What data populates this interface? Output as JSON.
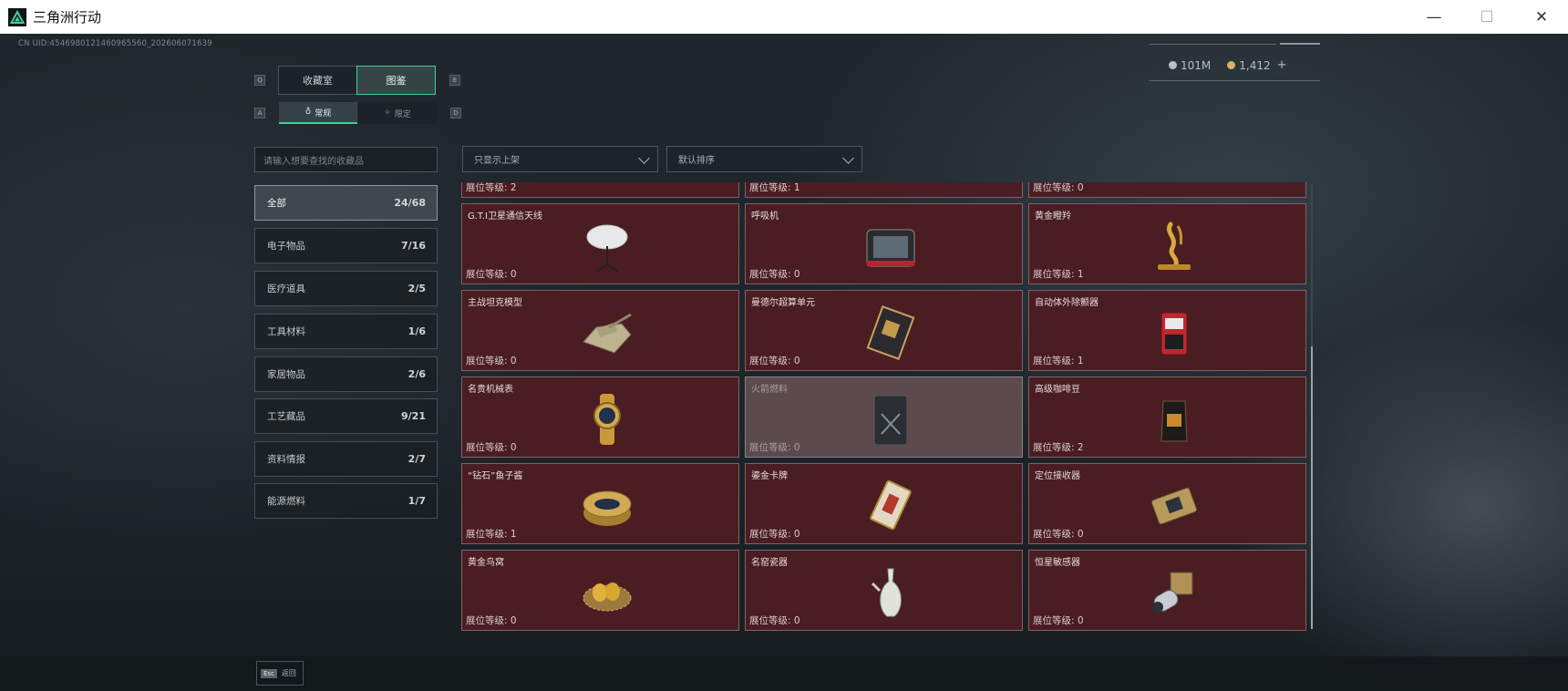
{
  "window": {
    "title": "三角洲行动",
    "controls": {
      "minimize": "—",
      "maximize": "☐",
      "close": "✕"
    }
  },
  "uid": "CN UID:4546980121460965560_202606071639",
  "currency": {
    "silver": "101M",
    "gold": "1,412",
    "add": "+"
  },
  "tabs": {
    "collection_room": "收藏室",
    "catalog": "图鉴"
  },
  "key_hints": {
    "left_tab": "Q",
    "right_tab": "E",
    "left_sub": "A",
    "right_sub": "D"
  },
  "subtabs": {
    "regular": "常规",
    "limited": "限定"
  },
  "search": {
    "placeholder": "请输入想要查找的收藏品"
  },
  "filters": {
    "display": "只显示上架",
    "sort": "默认排序"
  },
  "categories": [
    {
      "label": "全部",
      "count": "24/68"
    },
    {
      "label": "电子物品",
      "count": "7/16"
    },
    {
      "label": "医疗道具",
      "count": "2/5"
    },
    {
      "label": "工具材料",
      "count": "1/6"
    },
    {
      "label": "家居物品",
      "count": "2/6"
    },
    {
      "label": "工艺藏品",
      "count": "9/21"
    },
    {
      "label": "资料情报",
      "count": "2/7"
    },
    {
      "label": "能源燃料",
      "count": "1/7"
    }
  ],
  "partial_row": [
    "展位等级: 2",
    "展位等级: 1",
    "展位等级: 0"
  ],
  "items": [
    {
      "name": "G.T.I卫星通信天线",
      "level": "展位等级: 0",
      "icon": "satellite-dish-icon"
    },
    {
      "name": "呼吸机",
      "level": "展位等级: 0",
      "icon": "ventilator-icon"
    },
    {
      "name": "黄金瞪羚",
      "level": "展位等级: 1",
      "icon": "gold-gazelle-icon"
    },
    {
      "name": "主战坦克模型",
      "level": "展位等级: 0",
      "icon": "tank-model-icon"
    },
    {
      "name": "曼德尔超算单元",
      "level": "展位等级: 0",
      "icon": "supercomputer-unit-icon"
    },
    {
      "name": "自动体外除颤器",
      "level": "展位等级: 1",
      "icon": "defibrillator-icon"
    },
    {
      "name": "名贵机械表",
      "level": "展位等级: 0",
      "icon": "wristwatch-icon"
    },
    {
      "name": "火箭燃料",
      "level": "展位等级: 0",
      "icon": "rocket-fuel-icon",
      "dimmed": true
    },
    {
      "name": "高级咖啡豆",
      "level": "展位等级: 2",
      "icon": "coffee-bag-icon"
    },
    {
      "name": "“钻石”鱼子酱",
      "level": "展位等级: 1",
      "icon": "caviar-tin-icon"
    },
    {
      "name": "鎏金卡牌",
      "level": "展位等级: 0",
      "icon": "gold-card-icon"
    },
    {
      "name": "定位接收器",
      "level": "展位等级: 0",
      "icon": "gps-receiver-icon"
    },
    {
      "name": "黄金鸟窝",
      "level": "展位等级: 0",
      "icon": "golden-nest-icon"
    },
    {
      "name": "名窑瓷器",
      "level": "展位等级: 0",
      "icon": "porcelain-vase-icon"
    },
    {
      "name": "恒星敏感器",
      "level": "展位等级: 0",
      "icon": "star-sensor-icon"
    }
  ],
  "footer": {
    "key": "Esc",
    "label": "返回"
  },
  "colors": {
    "accent": "#3fcf9a",
    "card_bg": "#4a1d22",
    "card_border": "#7e6268"
  }
}
